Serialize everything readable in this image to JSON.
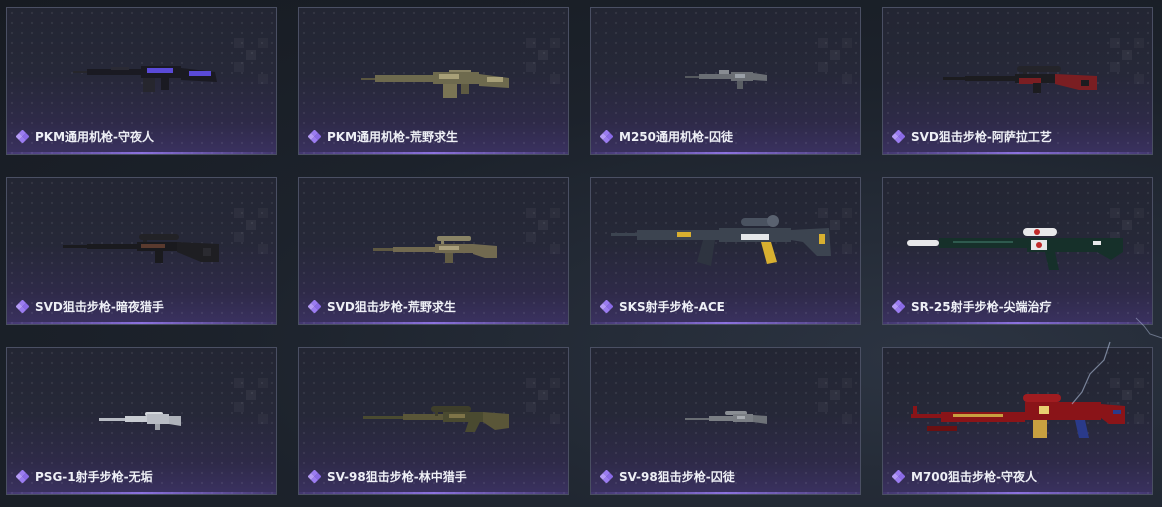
{
  "items": [
    {
      "label": "PKM通用机枪-守夜人",
      "rarity_color": "#9b7cf0",
      "weapon_icon": "machine-gun-icon",
      "colors": {
        "body": "#1a1a22",
        "accent": "#5a4ad8"
      }
    },
    {
      "label": "PKM通用机枪-荒野求生",
      "rarity_color": "#9b7cf0",
      "weapon_icon": "machine-gun-icon",
      "colors": {
        "body": "#6e6a4e",
        "accent": "#a8a078"
      }
    },
    {
      "label": "M250通用机枪-囚徒",
      "rarity_color": "#9b7cf0",
      "weapon_icon": "machine-gun-icon",
      "colors": {
        "body": "#6a6e74",
        "accent": "#9aa0a8"
      }
    },
    {
      "label": "SVD狙击步枪-阿萨拉工艺",
      "rarity_color": "#9b7cf0",
      "weapon_icon": "sniper-rifle-icon",
      "colors": {
        "body": "#1c1c20",
        "accent": "#7a1e22"
      }
    },
    {
      "label": "SVD狙击步枪-暗夜猎手",
      "rarity_color": "#9b7cf0",
      "weapon_icon": "sniper-rifle-icon",
      "colors": {
        "body": "#1a1a1e",
        "accent": "#5a3a2e"
      }
    },
    {
      "label": "SVD狙击步枪-荒野求生",
      "rarity_color": "#9b7cf0",
      "weapon_icon": "sniper-rifle-icon",
      "colors": {
        "body": "#726a50",
        "accent": "#aaa07c"
      }
    },
    {
      "label": "SKS射手步枪-ACE",
      "rarity_color": "#9b7cf0",
      "weapon_icon": "marksman-rifle-icon",
      "colors": {
        "body": "#3c4450",
        "accent": "#d8b030"
      }
    },
    {
      "label": "SR-25射手步枪-尖端治疗",
      "rarity_color": "#9b7cf0",
      "weapon_icon": "marksman-rifle-icon",
      "colors": {
        "body": "#16302a",
        "accent": "#e8e8ea"
      }
    },
    {
      "label": "PSG-1射手步枪-无垢",
      "rarity_color": "#9b7cf0",
      "weapon_icon": "marksman-rifle-icon",
      "colors": {
        "body": "#b8bcc4",
        "accent": "#e6e8ec"
      }
    },
    {
      "label": "SV-98狙击步枪-林中猎手",
      "rarity_color": "#9b7cf0",
      "weapon_icon": "sniper-rifle-icon",
      "colors": {
        "body": "#4a4a30",
        "accent": "#7e7448"
      }
    },
    {
      "label": "SV-98狙击步枪-囚徒",
      "rarity_color": "#9b7cf0",
      "weapon_icon": "sniper-rifle-icon",
      "colors": {
        "body": "#7a7e84",
        "accent": "#a8acb2"
      }
    },
    {
      "label": "M700狙击步枪-守夜人",
      "rarity_color": "#9b7cf0",
      "weapon_icon": "sniper-rifle-icon",
      "colors": {
        "body": "#8a1418",
        "accent": "#c8a040"
      }
    }
  ]
}
